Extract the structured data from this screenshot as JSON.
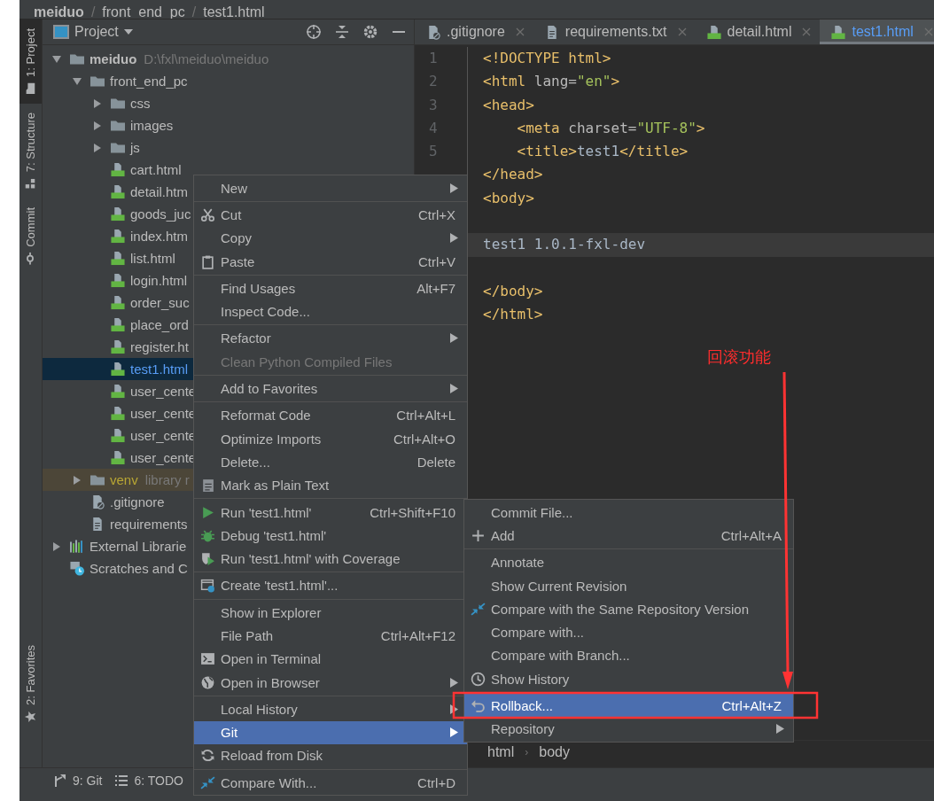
{
  "breadcrumb": {
    "separator": "/",
    "items": [
      "meiduo",
      "front_end_pc",
      "test1.html"
    ]
  },
  "tool_strip": {
    "top": [
      {
        "label": "1: Project",
        "selected": true
      },
      {
        "label": "7: Structure",
        "selected": false
      },
      {
        "label": "Commit",
        "selected": false
      }
    ],
    "bottom": [
      {
        "label": "2: Favorites",
        "selected": false
      }
    ]
  },
  "project_panel": {
    "title": "Project",
    "tree": [
      {
        "label": "meiduo",
        "hint": "D:\\fxl\\meiduo\\meiduo",
        "kind": "root",
        "expanded": true,
        "selected": false,
        "children": [
          {
            "label": "front_end_pc",
            "kind": "folder",
            "expanded": true,
            "selected": false,
            "children": [
              {
                "label": "css",
                "kind": "folder",
                "expanded": false,
                "selected": false
              },
              {
                "label": "images",
                "kind": "folder",
                "expanded": false,
                "selected": false
              },
              {
                "label": "js",
                "kind": "folder",
                "expanded": false,
                "selected": false
              },
              {
                "label": "cart.html",
                "kind": "html",
                "selected": false
              },
              {
                "label": "detail.htm",
                "kind": "html",
                "selected": false
              },
              {
                "label": "goods_juc",
                "kind": "html",
                "selected": false
              },
              {
                "label": "index.htm",
                "kind": "html",
                "selected": false
              },
              {
                "label": "list.html",
                "kind": "html",
                "selected": false
              },
              {
                "label": "login.html",
                "kind": "html",
                "selected": false
              },
              {
                "label": "order_suc",
                "kind": "html",
                "selected": false
              },
              {
                "label": "place_ord",
                "kind": "html",
                "selected": false
              },
              {
                "label": "register.ht",
                "kind": "html",
                "selected": false
              },
              {
                "label": "test1.html",
                "kind": "html",
                "selected": true
              },
              {
                "label": "user_cente",
                "kind": "html",
                "selected": false
              },
              {
                "label": "user_cente",
                "kind": "html",
                "selected": false
              },
              {
                "label": "user_cente",
                "kind": "html",
                "selected": false
              },
              {
                "label": "user_cente",
                "kind": "html",
                "selected": false
              }
            ]
          },
          {
            "label": "venv",
            "hint": "library r",
            "kind": "excluded",
            "expanded": false,
            "selected": false
          },
          {
            "label": ".gitignore",
            "kind": "gitignore",
            "selected": false
          },
          {
            "label": "requirements",
            "kind": "text",
            "selected": false
          }
        ]
      },
      {
        "label": "External Librarie",
        "kind": "libraries",
        "expanded": false,
        "selected": false
      },
      {
        "label": "Scratches and C",
        "kind": "scratches",
        "selected": false
      }
    ]
  },
  "editor": {
    "tabs": [
      {
        "label": ".gitignore",
        "kind": "gitignore",
        "selected": false
      },
      {
        "label": "requirements.txt",
        "kind": "text",
        "selected": false
      },
      {
        "label": "detail.html",
        "kind": "html",
        "selected": false
      },
      {
        "label": "test1.html",
        "kind": "html",
        "selected": true
      }
    ],
    "lines": [
      {
        "number": "1",
        "current": false,
        "text": "<!DOCTYPE html>"
      },
      {
        "number": "2",
        "current": false,
        "text": "<html lang=\"en\">"
      },
      {
        "number": "3",
        "current": false,
        "text": "<head>"
      },
      {
        "number": "4",
        "current": false,
        "text": "    <meta charset=\"UTF-8\">"
      },
      {
        "number": "5",
        "current": false,
        "text": "    <title>test1</title>"
      },
      {
        "current": false,
        "text": "</head>"
      },
      {
        "current": false,
        "text": "<body>"
      },
      {
        "current": false
      },
      {
        "current": true,
        "text": "test1 1.0.1-fxl-dev"
      },
      {
        "current": false
      },
      {
        "current": false,
        "text": "</body>"
      },
      {
        "current": false,
        "text": "</html>"
      }
    ],
    "path": {
      "separator": "›",
      "items": [
        "html",
        "body"
      ]
    }
  },
  "bottom_tools": [
    {
      "label": "9: Git"
    },
    {
      "label": "6: TODO"
    }
  ],
  "context_menu": {
    "items": [
      {
        "kind": "item",
        "label": "New",
        "submenu": true,
        "selected": false,
        "disabled": false
      },
      {
        "kind": "separator"
      },
      {
        "kind": "item",
        "label": "Cut",
        "shortcut": "Ctrl+X",
        "selected": false,
        "disabled": false
      },
      {
        "kind": "item",
        "label": "Copy",
        "submenu": true,
        "selected": false,
        "disabled": false
      },
      {
        "kind": "item",
        "label": "Paste",
        "shortcut": "Ctrl+V",
        "selected": false,
        "disabled": false
      },
      {
        "kind": "separator"
      },
      {
        "kind": "item",
        "label": "Find Usages",
        "shortcut": "Alt+F7",
        "selected": false,
        "disabled": false
      },
      {
        "kind": "item",
        "label": "Inspect Code...",
        "selected": false,
        "disabled": false
      },
      {
        "kind": "separator"
      },
      {
        "kind": "item",
        "label": "Refactor",
        "submenu": true,
        "selected": false,
        "disabled": false
      },
      {
        "kind": "item",
        "label": "Clean Python Compiled Files",
        "selected": false,
        "disabled": true
      },
      {
        "kind": "separator"
      },
      {
        "kind": "item",
        "label": "Add to Favorites",
        "submenu": true,
        "selected": false,
        "disabled": false
      },
      {
        "kind": "separator"
      },
      {
        "kind": "item",
        "label": "Reformat Code",
        "shortcut": "Ctrl+Alt+L",
        "selected": false,
        "disabled": false
      },
      {
        "kind": "item",
        "label": "Optimize Imports",
        "shortcut": "Ctrl+Alt+O",
        "selected": false,
        "disabled": false
      },
      {
        "kind": "item",
        "label": "Delete...",
        "shortcut": "Delete",
        "selected": false,
        "disabled": false
      },
      {
        "kind": "item",
        "label": "Mark as Plain Text",
        "selected": false,
        "disabled": false
      },
      {
        "kind": "separator"
      },
      {
        "kind": "item",
        "label": "Run 'test1.html'",
        "shortcut": "Ctrl+Shift+F10",
        "selected": false,
        "disabled": false
      },
      {
        "kind": "item",
        "label": "Debug 'test1.html'",
        "selected": false,
        "disabled": false
      },
      {
        "kind": "item",
        "label": "Run 'test1.html' with Coverage",
        "selected": false,
        "disabled": false
      },
      {
        "kind": "separator"
      },
      {
        "kind": "item",
        "label": "Create 'test1.html'...",
        "selected": false,
        "disabled": false
      },
      {
        "kind": "separator"
      },
      {
        "kind": "item",
        "label": "Show in Explorer",
        "selected": false,
        "disabled": false
      },
      {
        "kind": "item",
        "label": "File Path",
        "shortcut": "Ctrl+Alt+F12",
        "selected": false,
        "disabled": false
      },
      {
        "kind": "item",
        "label": "Open in Terminal",
        "selected": false,
        "disabled": false
      },
      {
        "kind": "item",
        "label": "Open in Browser",
        "submenu": true,
        "selected": false,
        "disabled": false
      },
      {
        "kind": "separator"
      },
      {
        "kind": "item",
        "label": "Local History",
        "submenu": true,
        "selected": false,
        "disabled": false
      },
      {
        "kind": "item",
        "label": "Git",
        "submenu": true,
        "selected": true,
        "disabled": false
      },
      {
        "kind": "item",
        "label": "Reload from Disk",
        "selected": false,
        "disabled": false
      },
      {
        "kind": "separator"
      },
      {
        "kind": "item",
        "label": "Compare With...",
        "shortcut": "Ctrl+D",
        "selected": false,
        "disabled": false
      }
    ]
  },
  "git_submenu": {
    "items": [
      {
        "kind": "item",
        "label": "Commit File...",
        "selected": false,
        "disabled": false
      },
      {
        "kind": "item",
        "label": "Add",
        "shortcut": "Ctrl+Alt+A",
        "selected": false,
        "disabled": false
      },
      {
        "kind": "separator"
      },
      {
        "kind": "item",
        "label": "Annotate",
        "selected": false,
        "disabled": false
      },
      {
        "kind": "item",
        "label": "Show Current Revision",
        "selected": false,
        "disabled": false
      },
      {
        "kind": "item",
        "label": "Compare with the Same Repository Version",
        "selected": false,
        "disabled": false
      },
      {
        "kind": "item",
        "label": "Compare with...",
        "selected": false,
        "disabled": false
      },
      {
        "kind": "item",
        "label": "Compare with Branch...",
        "selected": false,
        "disabled": false
      },
      {
        "kind": "item",
        "label": "Show History",
        "selected": false,
        "disabled": false
      },
      {
        "kind": "separator"
      },
      {
        "kind": "item",
        "label": "Rollback...",
        "shortcut": "Ctrl+Alt+Z",
        "selected": true,
        "disabled": false
      },
      {
        "kind": "item",
        "label": "Repository",
        "submenu": true,
        "selected": false,
        "disabled": false
      }
    ]
  },
  "annotation": {
    "label": "回滚功能"
  }
}
